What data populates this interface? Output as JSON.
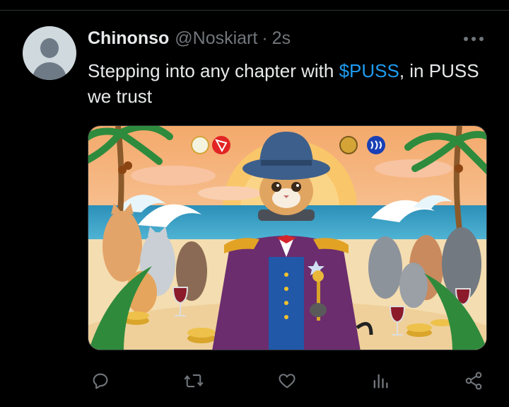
{
  "tweet": {
    "author_name": "Chinonso",
    "handle": "@Noskiart",
    "separator": "·",
    "timestamp": "2s",
    "text_before": "Stepping into any chapter with ",
    "cashtag": "$PUSS",
    "text_after": ", in PUSS we trust"
  },
  "media": {
    "description_icons": [
      "coin-face-icon",
      "tron-logo-icon",
      "coin-monkey-icon",
      "steem-logo-icon"
    ]
  },
  "actions": {
    "reply_icon": "speech-bubble-icon",
    "retweet_icon": "retweet-arrows-icon",
    "like_icon": "heart-icon",
    "views_icon": "bar-chart-icon",
    "share_icon": "share-nodes-icon"
  },
  "colors": {
    "background": "#000000",
    "text": "#e7e9ea",
    "muted": "#71767b",
    "link": "#1d9bf0"
  }
}
